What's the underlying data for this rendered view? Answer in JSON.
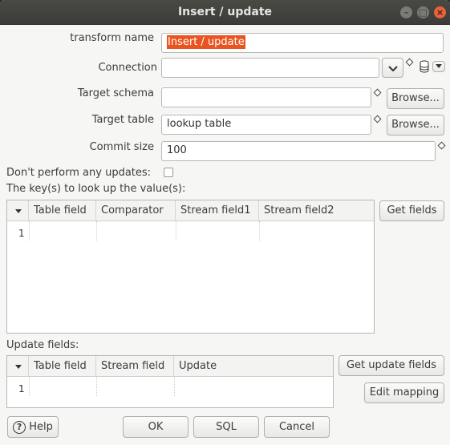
{
  "window": {
    "title": "Insert / update"
  },
  "form": {
    "transform_name": {
      "label": "transform name",
      "value": "Insert / update"
    },
    "connection": {
      "label": "Connection",
      "value": ""
    },
    "target_schema": {
      "label": "Target schema",
      "value": "",
      "browse": "Browse..."
    },
    "target_table": {
      "label": "Target table",
      "value": "lookup table",
      "browse": "Browse..."
    },
    "commit_size": {
      "label": "Commit size",
      "value": "100"
    },
    "no_updates": {
      "label": "Don't perform any updates:",
      "checked": false
    }
  },
  "keys": {
    "label": "The key(s) to look up the value(s):",
    "columns": [
      "Table field",
      "Comparator",
      "Stream field1",
      "Stream field2"
    ],
    "rows": [
      {
        "num": "1"
      }
    ],
    "get_fields": "Get fields"
  },
  "update": {
    "label": "Update fields:",
    "columns": [
      "Table field",
      "Stream field",
      "Update"
    ],
    "rows": [
      {
        "num": "1"
      }
    ],
    "get_update_fields": "Get update fields",
    "edit_mapping": "Edit mapping"
  },
  "footer": {
    "help": "Help",
    "ok": "OK",
    "sql": "SQL",
    "cancel": "Cancel"
  },
  "colors": {
    "accent": "#e95420",
    "titlebar": "#3b3b37"
  }
}
